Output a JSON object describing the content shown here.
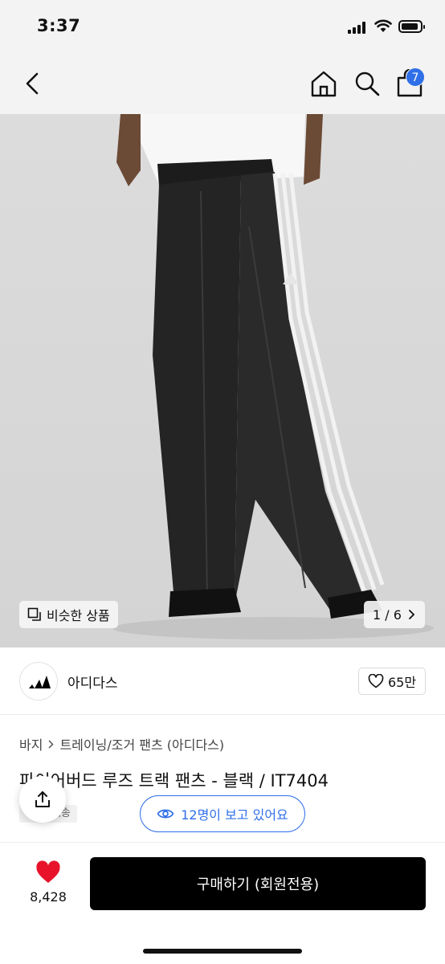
{
  "status_bar": {
    "time": "3:37"
  },
  "header": {
    "cart_count": "7"
  },
  "product_image": {
    "similar_label": "비슷한 상품",
    "page_current": "1",
    "page_total": "6",
    "page_separator": "/"
  },
  "brand": {
    "name": "아디다스",
    "like_count": "65만"
  },
  "breadcrumb": [
    "바지",
    "트레이닝/조거 팬츠 (아디다스)"
  ],
  "product": {
    "title": "파이어버드 루즈 트랙 팬츠 - 블랙 / IT7404",
    "shipping_badge": "배송"
  },
  "viewers": {
    "label": "12명이 보고 있어요"
  },
  "bottom_bar": {
    "wish_count": "8,428",
    "buy_label": "구매하기 (회원전용)"
  },
  "colors": {
    "accent_blue": "#2f6fe8",
    "heart_red": "#e8132b",
    "buy_black": "#000000"
  }
}
